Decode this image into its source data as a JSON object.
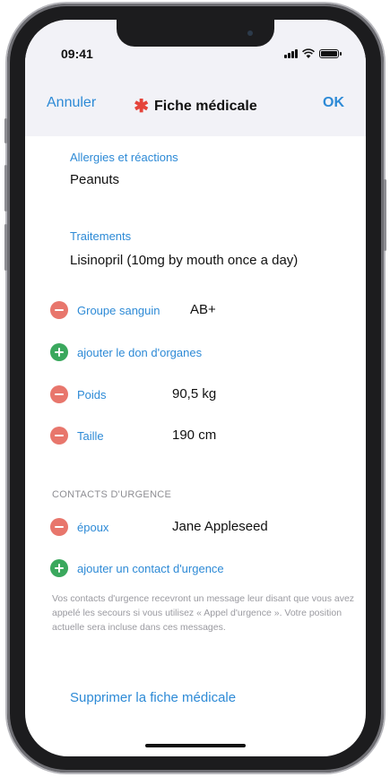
{
  "status_bar": {
    "time": "09:41"
  },
  "nav": {
    "cancel_label": "Annuler",
    "title": "Fiche médicale",
    "done_label": "OK"
  },
  "allergies": {
    "label": "Allergies et réactions",
    "value": "Peanuts"
  },
  "medications": {
    "label": "Traitements",
    "value": "Lisinopril (10mg by mouth once a day)"
  },
  "blood_type": {
    "label": "Groupe sanguin",
    "value": "AB+"
  },
  "organ_donor": {
    "add_label": "ajouter le don d'organes"
  },
  "weight": {
    "label": "Poids",
    "value": "90,5 kg"
  },
  "height": {
    "label": "Taille",
    "value": "190 cm"
  },
  "emergency": {
    "header": "CONTACTS D'URGENCE",
    "contact": {
      "relation": "époux",
      "name": "Jane Appleseed"
    },
    "add_label": "ajouter un contact d'urgence",
    "footnote": "Vos contacts d'urgence recevront un message leur disant que vous avez appelé les secours si vous utilisez « Appel d'urgence ». Votre position actuelle sera incluse dans ces messages."
  },
  "delete_label": "Supprimer la fiche médicale",
  "colors": {
    "accent": "#2d8ad6",
    "remove": "#e8766c",
    "add": "#3aa85d",
    "asterisk": "#e5443b"
  }
}
